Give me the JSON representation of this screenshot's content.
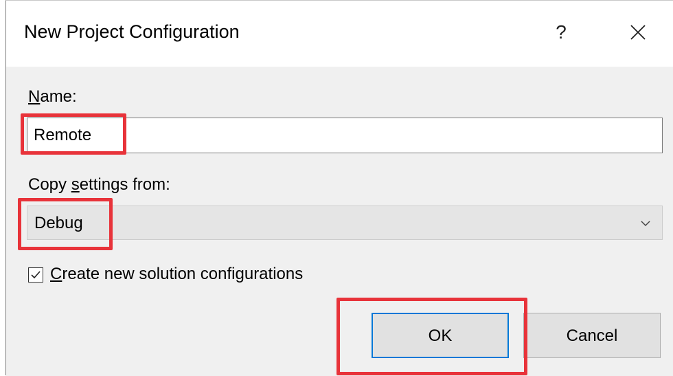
{
  "dialog": {
    "title": "New Project Configuration",
    "help_label": "?",
    "close_icon": "close-icon"
  },
  "form": {
    "name_label_prefix": "N",
    "name_label_rest": "ame:",
    "name_value": "Remote",
    "copy_label_prefix": "Copy ",
    "copy_label_key": "s",
    "copy_label_rest": "ettings from:",
    "copy_value": "Debug",
    "chevron_icon": "chevron-down-icon",
    "checkbox_checked": true,
    "checkbox_label_key": "C",
    "checkbox_label_rest": "reate new solution configurations"
  },
  "buttons": {
    "ok_label": "OK",
    "cancel_label": "Cancel"
  },
  "colors": {
    "highlight": "#e8333a",
    "focus_border": "#0078d7"
  }
}
